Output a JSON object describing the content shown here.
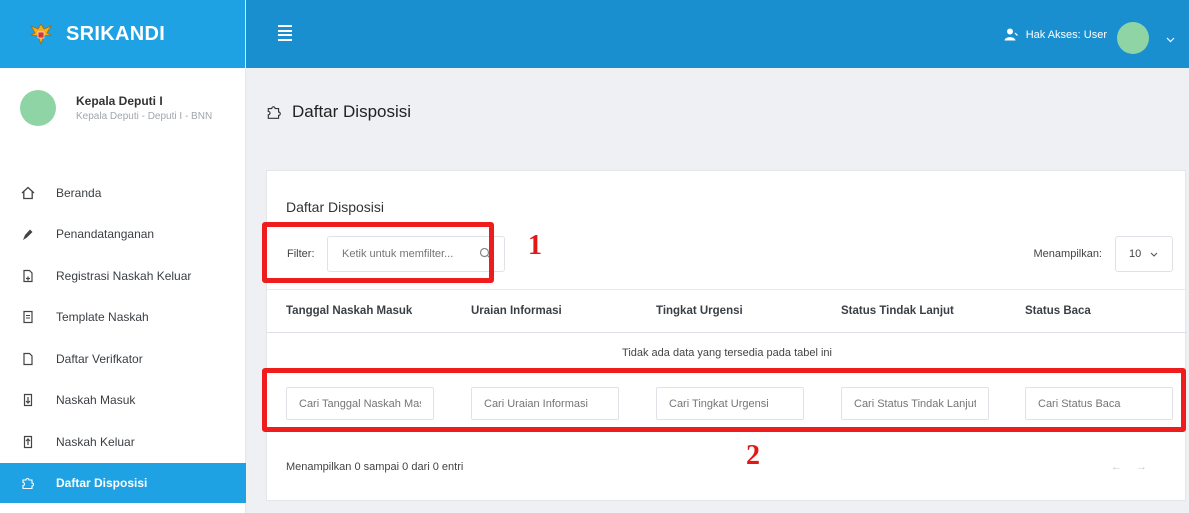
{
  "app": {
    "name": "SRIKANDI"
  },
  "profile": {
    "name": "Kepala Deputi I",
    "role": "Kepala Deputi - Deputi I - BNN"
  },
  "sidebar": {
    "items": [
      {
        "label": "Beranda",
        "icon": "home-icon"
      },
      {
        "label": "Penandatanganan",
        "icon": "pen-icon"
      },
      {
        "label": "Registrasi Naskah Keluar",
        "icon": "file-plus-icon"
      },
      {
        "label": "Template Naskah",
        "icon": "file-text-icon"
      },
      {
        "label": "Daftar Verifkator",
        "icon": "file-check-icon"
      },
      {
        "label": "Naskah Masuk",
        "icon": "file-in-icon"
      },
      {
        "label": "Naskah Keluar",
        "icon": "file-out-icon"
      },
      {
        "label": "Daftar Disposisi",
        "icon": "puzzle-icon",
        "active": true
      }
    ]
  },
  "topbar": {
    "access_label": "Hak Akses: User"
  },
  "page": {
    "title": "Daftar Disposisi"
  },
  "card": {
    "title": "Daftar Disposisi",
    "filter_label": "Filter:",
    "filter_placeholder": "Ketik untuk memfilter...",
    "show_label": "Menampilkan:",
    "show_value": "10",
    "columns": [
      "Tanggal Naskah Masuk",
      "Uraian Informasi",
      "Tingkat Urgensi",
      "Status Tindak Lanjut",
      "Status Baca"
    ],
    "empty_text": "Tidak ada data yang tersedia pada tabel ini",
    "search_placeholders": [
      "Cari Tanggal Naskah Masuk",
      "Cari Uraian Informasi",
      "Cari Tingkat Urgensi",
      "Cari Status Tindak Lanjut",
      "Cari Status Baca"
    ],
    "info_text": "Menampilkan 0 sampai 0 dari 0 entri",
    "pager": {
      "prev": "←",
      "next": "→"
    }
  },
  "annotations": {
    "one": "1",
    "two": "2",
    "color": "#ee1c1c"
  },
  "colors": {
    "brand": "#1ea2e4",
    "topbar": "#1a8fd0",
    "avatar": "#8fd4a4"
  }
}
